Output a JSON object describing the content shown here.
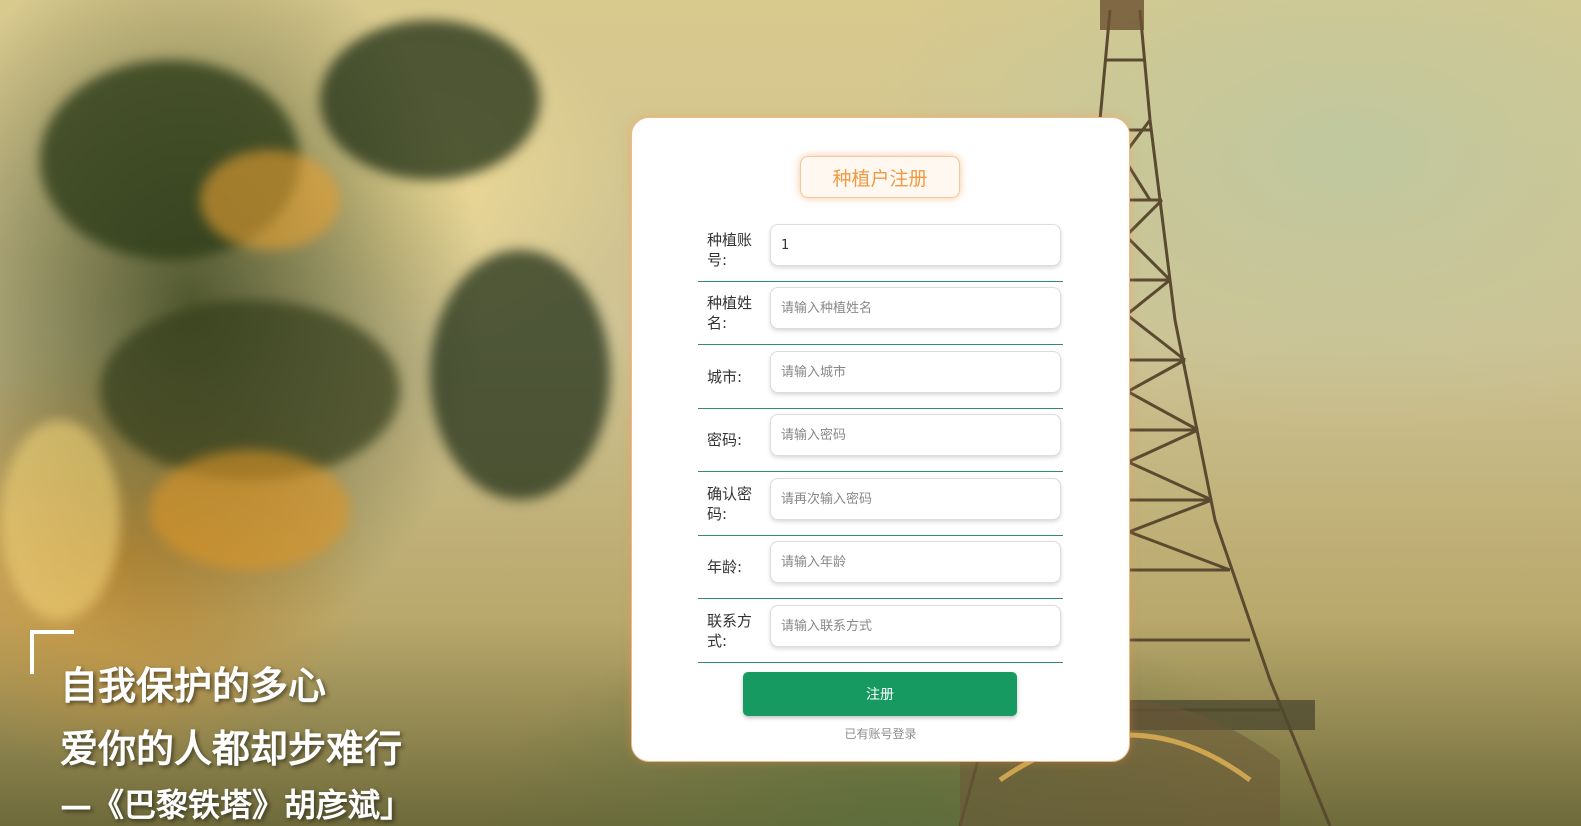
{
  "background": {
    "quote_lines": [
      "自我保护的多心",
      "爱你的人都却步难行",
      "—《巴黎铁塔》胡彦斌」"
    ]
  },
  "form": {
    "title": "种植户注册",
    "fields": [
      {
        "label": "种植账号:",
        "value": "1",
        "placeholder": ""
      },
      {
        "label": "种植姓名:",
        "value": "",
        "placeholder": "请输入种植姓名"
      },
      {
        "label": "城市:",
        "value": "",
        "placeholder": "请输入城市"
      },
      {
        "label": "密码:",
        "value": "",
        "placeholder": "请输入密码"
      },
      {
        "label": "确认密码:",
        "value": "",
        "placeholder": "请再次输入密码"
      },
      {
        "label": "年龄:",
        "value": "",
        "placeholder": "请输入年龄"
      },
      {
        "label": "联系方式:",
        "value": "",
        "placeholder": "请输入联系方式"
      }
    ],
    "submit_label": "注册",
    "login_link": "已有账号登录"
  },
  "colors": {
    "title": "#ef9a43",
    "button": "#169a62",
    "divider": "#2f8c74"
  }
}
